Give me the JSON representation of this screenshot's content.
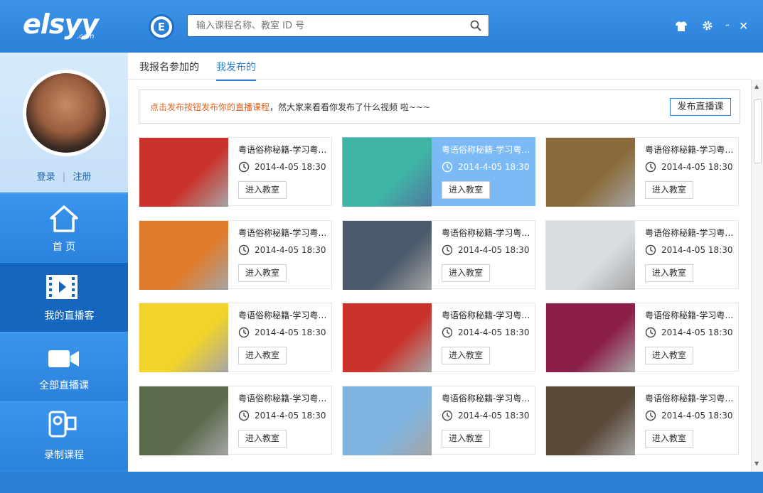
{
  "app": {
    "logo_text": "elsyy",
    "logo_sub": ".com",
    "badge_letter": "E"
  },
  "search": {
    "placeholder": "输入课程名称、教室 ID 号"
  },
  "window": {
    "shirt_icon": "shirt-icon",
    "settings_icon": "gear-icon",
    "minimize": "-",
    "close": "✕"
  },
  "sidebar": {
    "login": "登录",
    "separator": "|",
    "register": "注册",
    "items": [
      {
        "label": "首 页",
        "icon": "home-icon"
      },
      {
        "label": "我的直播客",
        "icon": "film-icon"
      },
      {
        "label": "全部直播课",
        "icon": "video-camera-icon"
      },
      {
        "label": "录制课程",
        "icon": "camcorder-icon"
      }
    ]
  },
  "tabs": [
    {
      "label": "我报名参加的"
    },
    {
      "label": "我发布的"
    }
  ],
  "notice": {
    "highlight": "点击发布按钮发布你的直播课程",
    "rest": "，然大家来看看你发布了什么视频 啦~~~",
    "button": "发布直播课"
  },
  "cards": [
    {
      "title": "粤语俗称秘籍-学习粤…",
      "time": "2014-4-05  18:30",
      "button": "进入教室",
      "thumb_color": "#c9332b"
    },
    {
      "title": "粤语俗称秘籍-学习粤…",
      "time": "2014-4-05  18:30",
      "button": "进入教室",
      "thumb_color": "#3fb5a5"
    },
    {
      "title": "粤语俗称秘籍-学习粤…",
      "time": "2014-4-05  18:30",
      "button": "进入教室",
      "thumb_color": "#8a6a3a"
    },
    {
      "title": "粤语俗称秘籍-学习粤…",
      "time": "2014-4-05  18:30",
      "button": "进入教室",
      "thumb_color": "#e07a2a"
    },
    {
      "title": "粤语俗称秘籍-学习粤…",
      "time": "2014-4-05  18:30",
      "button": "进入教室",
      "thumb_color": "#4b5a6a"
    },
    {
      "title": "粤语俗称秘籍-学习粤…",
      "time": "2014-4-05  18:30",
      "button": "进入教室",
      "thumb_color": "#d9dee3"
    },
    {
      "title": "粤语俗称秘籍-学习粤…",
      "time": "2014-4-05  18:30",
      "button": "进入教室",
      "thumb_color": "#f2d32a"
    },
    {
      "title": "粤语俗称秘籍-学习粤…",
      "time": "2014-4-05  18:30",
      "button": "进入教室",
      "thumb_color": "#c9332b"
    },
    {
      "title": "粤语俗称秘籍-学习粤…",
      "time": "2014-4-05  18:30",
      "button": "进入教室",
      "thumb_color": "#8c1f4a"
    },
    {
      "title": "粤语俗称秘籍-学习粤…",
      "time": "2014-4-05  18:30",
      "button": "进入教室",
      "thumb_color": "#5a6a4a"
    },
    {
      "title": "粤语俗称秘籍-学习粤…",
      "time": "2014-4-05  18:30",
      "button": "进入教室",
      "thumb_color": "#7fb3e0"
    },
    {
      "title": "粤语俗称秘籍-学习粤…",
      "time": "2014-4-05  18:30",
      "button": "进入教室",
      "thumb_color": "#5a4a3a"
    }
  ],
  "colors": {
    "accent": "#2a7fd6",
    "highlight": "#e8601c",
    "hover_card": "#7bb9f7"
  }
}
